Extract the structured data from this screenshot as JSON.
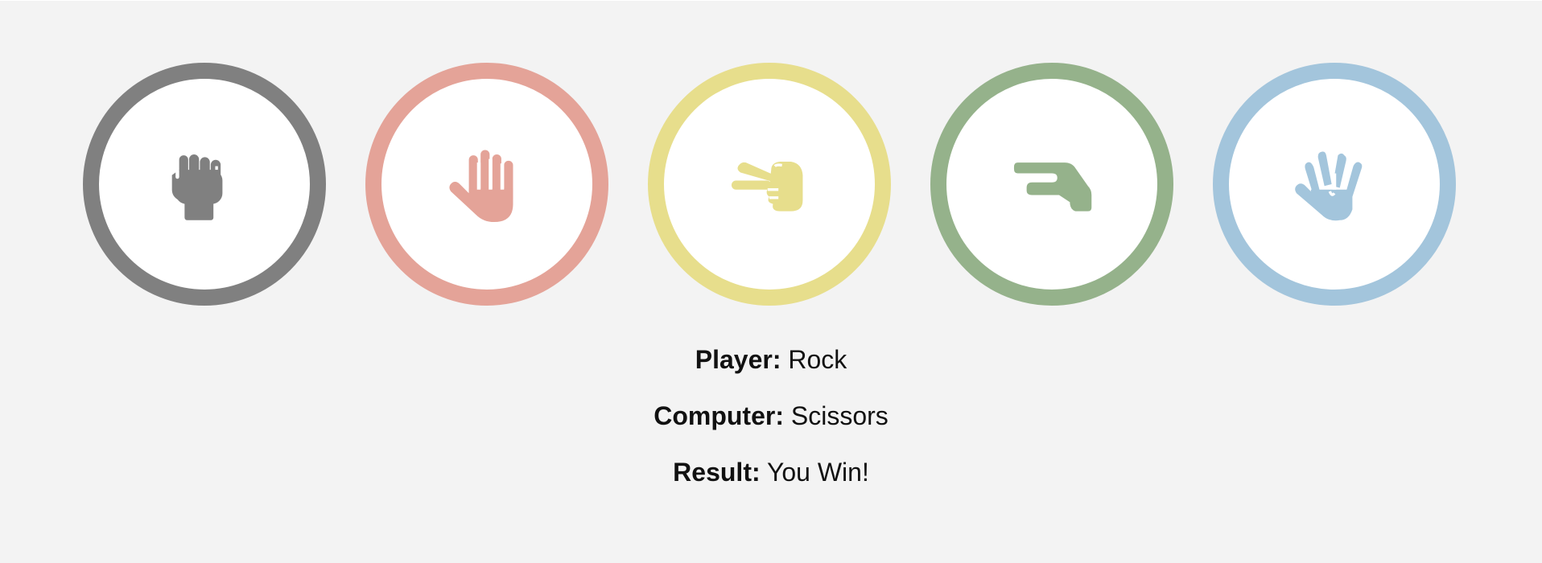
{
  "choices": [
    {
      "id": "rock",
      "icon": "fist-icon",
      "color": "#808080"
    },
    {
      "id": "paper",
      "icon": "open-hand-icon",
      "color": "#e4a398"
    },
    {
      "id": "scissors",
      "icon": "scissors-hand-icon",
      "color": "#e7de8c"
    },
    {
      "id": "lizard",
      "icon": "lizard-hand-icon",
      "color": "#95b28b"
    },
    {
      "id": "spock",
      "icon": "vulcan-salute-icon",
      "color": "#a3c5dc"
    }
  ],
  "status": {
    "player_label": "Player:",
    "player_value": "Rock",
    "computer_label": "Computer:",
    "computer_value": "Scissors",
    "result_label": "Result:",
    "result_value": "You Win!"
  }
}
